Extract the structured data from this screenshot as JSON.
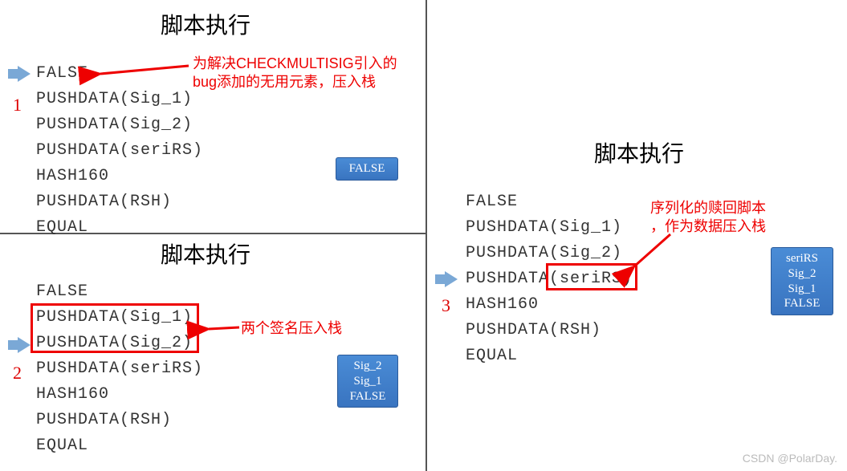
{
  "titles": {
    "t1": "脚本执行",
    "t2": "脚本执行",
    "t3": "脚本执行"
  },
  "nums": {
    "n1": "1",
    "n2": "2",
    "n3": "3"
  },
  "annotations": {
    "a1_line1": "为解决CHECKMULTISIG引入的",
    "a1_line2": "bug添加的无用元素，压入栈",
    "a2": "两个签名压入栈",
    "a3_line1": "序列化的赎回脚本",
    "a3_line2": "，作为数据压入栈"
  },
  "script": {
    "l1": "FALSE",
    "l2": "PUSHDATA(Sig_1)",
    "l3": "PUSHDATA(Sig_2)",
    "l4": "PUSHDATA(seriRS)",
    "l4_a": "PUSHDATA",
    "l4_b": "(seriRS)",
    "l5": "HASH160",
    "l6": "PUSHDATA(RSH)",
    "l7": "EQUAL"
  },
  "stacks": {
    "s1": [
      "FALSE"
    ],
    "s2": [
      "Sig_2",
      "Sig_1",
      "FALSE"
    ],
    "s3": [
      "seriRS",
      "Sig_2",
      "Sig_1",
      "FALSE"
    ]
  },
  "watermark": "CSDN @PolarDay."
}
